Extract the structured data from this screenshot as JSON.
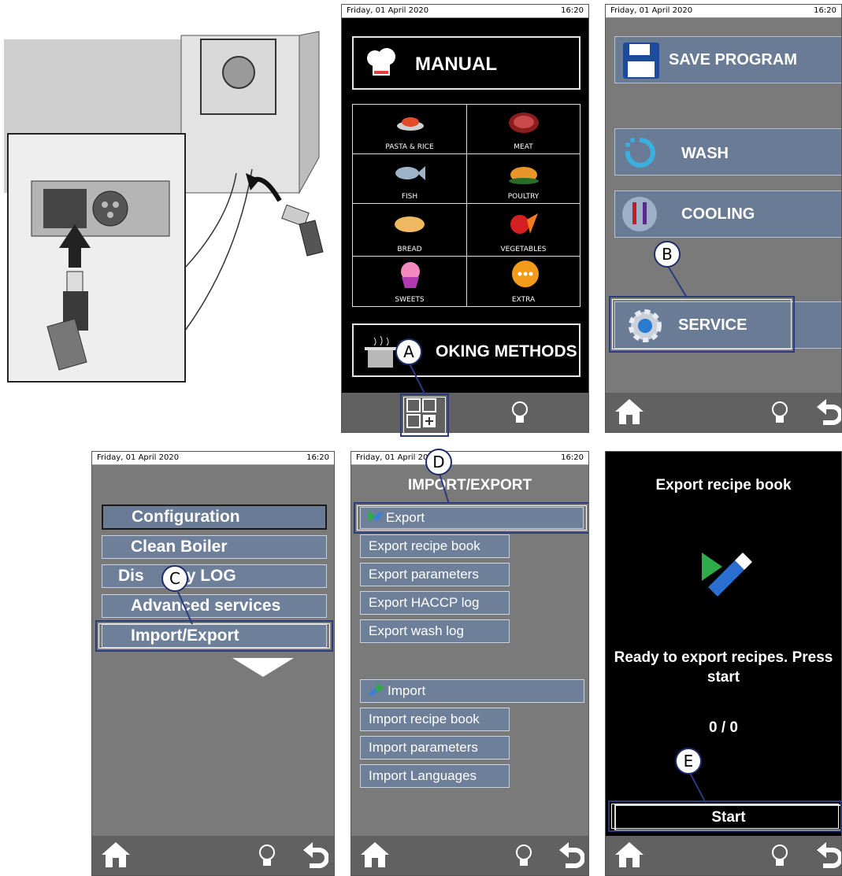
{
  "status": {
    "date": "Friday, 01 April 2020",
    "time": "16:20"
  },
  "screen_a": {
    "manual_label": "MANUAL",
    "categories": [
      "PASTA & RICE",
      "MEAT",
      "FISH",
      "POULTRY",
      "BREAD",
      "VEGETABLES",
      "SWEETS",
      "EXTRA"
    ],
    "cooking_methods_label": "OKING METHODS"
  },
  "screen_b": {
    "items": [
      "SAVE PROGRAM",
      "WASH",
      "COOLING",
      "SERVICE"
    ]
  },
  "screen_c": {
    "items": [
      "Configuration",
      "Clean Boiler",
      "Dis",
      "y LOG",
      "Advanced services",
      "Import/Export"
    ]
  },
  "screen_d": {
    "title_a": "IM",
    "title_b": "PORT/EXPORT",
    "export_header": "Export",
    "export_items": [
      "Export recipe book",
      "Export parameters",
      "Export HACCP log",
      "Export wash log"
    ],
    "import_header": "Import",
    "import_items": [
      "Import recipe book",
      "Import parameters",
      "Import Languages"
    ]
  },
  "screen_e": {
    "title": "Export recipe book",
    "message": "Ready to export recipes. Press start",
    "progress": "0 / 0",
    "start_label": "Start"
  },
  "callouts": [
    "A",
    "B",
    "C",
    "D",
    "E"
  ],
  "colors": {
    "accent": "#2a3a80",
    "button_fill": "#6e7f99",
    "screen_gray": "#7a7a7a"
  }
}
